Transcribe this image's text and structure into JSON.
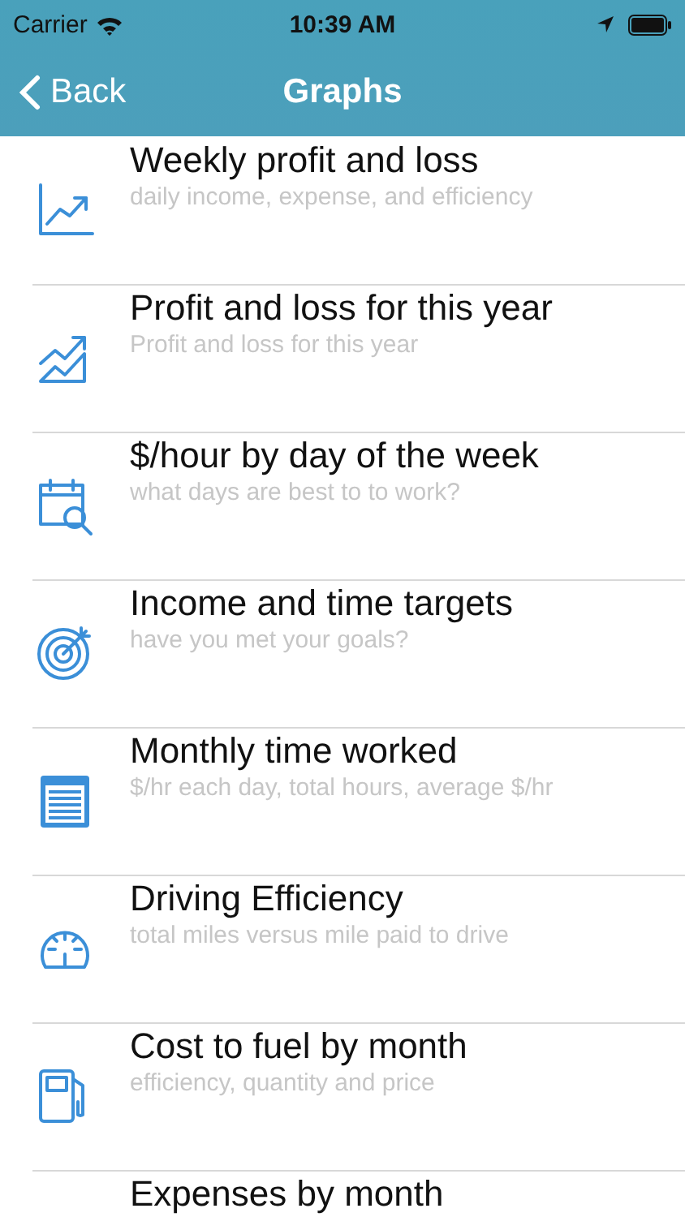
{
  "status_bar": {
    "carrier": "Carrier",
    "time": "10:39 AM"
  },
  "nav_bar": {
    "back": "Back",
    "title": "Graphs"
  },
  "items": [
    {
      "title": "Weekly profit and loss",
      "subtitle": "daily income, expense, and efficiency"
    },
    {
      "title": "Profit and loss for this year",
      "subtitle": "Profit and loss for this year"
    },
    {
      "title": "$/hour by day of the week",
      "subtitle": "what days are best to to work?"
    },
    {
      "title": "Income and time targets",
      "subtitle": "have you met your goals?"
    },
    {
      "title": "Monthly time worked",
      "subtitle": "$/hr each day, total hours, average $/hr"
    },
    {
      "title": "Driving Efficiency",
      "subtitle": "total miles versus mile paid to drive"
    },
    {
      "title": "Cost to fuel by month",
      "subtitle": "efficiency, quantity and price"
    },
    {
      "title": "Expenses by month"
    }
  ]
}
